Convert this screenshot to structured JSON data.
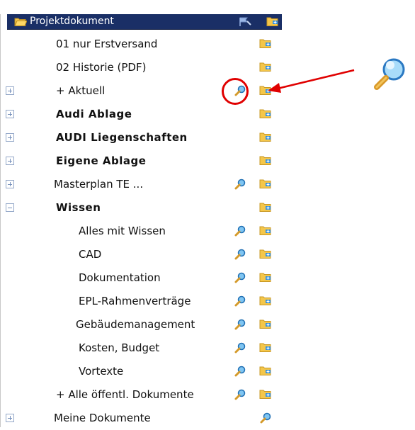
{
  "tree": {
    "header": {
      "title": "Projektdokument",
      "folder_icon": "folder-open-icon",
      "flag_icon": "flag-icon",
      "add_icon": "folder-add-icon"
    },
    "items": [
      {
        "label": "01 nur Erstversand",
        "bold": false,
        "expander": "none",
        "search": false
      },
      {
        "label": "02 Historie (PDF)",
        "bold": false,
        "expander": "none",
        "search": false
      },
      {
        "label": "+ Aktuell",
        "bold": false,
        "expander": "plus",
        "search": true
      },
      {
        "label": "Audi Ablage",
        "bold": true,
        "expander": "plus",
        "search": false
      },
      {
        "label": "AUDI Liegenschaften",
        "bold": true,
        "expander": "plus",
        "search": false
      },
      {
        "label": "Eigene Ablage",
        "bold": true,
        "expander": "plus",
        "search": false
      },
      {
        "label": "Masterplan TE   ...",
        "bold": false,
        "expander": "plus",
        "search": true
      },
      {
        "label": "Wissen",
        "bold": true,
        "expander": "minus",
        "search": false
      },
      {
        "label": "Alles mit Wissen",
        "bold": false,
        "expander": "none",
        "search": true
      },
      {
        "label": "CAD",
        "bold": false,
        "expander": "none",
        "search": true
      },
      {
        "label": "Dokumentation",
        "bold": false,
        "expander": "none",
        "search": true
      },
      {
        "label": "EPL-Rahmenverträge",
        "bold": false,
        "expander": "none",
        "search": true
      },
      {
        "label": "Gebäudemanagement",
        "bold": false,
        "expander": "none",
        "search": true
      },
      {
        "label": "Kosten, Budget",
        "bold": false,
        "expander": "none",
        "search": true
      },
      {
        "label": "Vortexte",
        "bold": false,
        "expander": "none",
        "search": true
      },
      {
        "label": "+ Alle öffentl. Dokumente",
        "bold": false,
        "expander": "none",
        "search": true
      },
      {
        "label": "Meine Dokumente",
        "bold": false,
        "expander": "plus",
        "search": true
      }
    ]
  },
  "annotation": {
    "highlight_color": "#e00000",
    "callout_icon": "search-magnifier-icon"
  },
  "colors": {
    "header_bg": "#1a2f66",
    "header_text": "#ffffff",
    "folder_yellow": "#f4c64a",
    "add_blue": "#2f8fe0"
  }
}
